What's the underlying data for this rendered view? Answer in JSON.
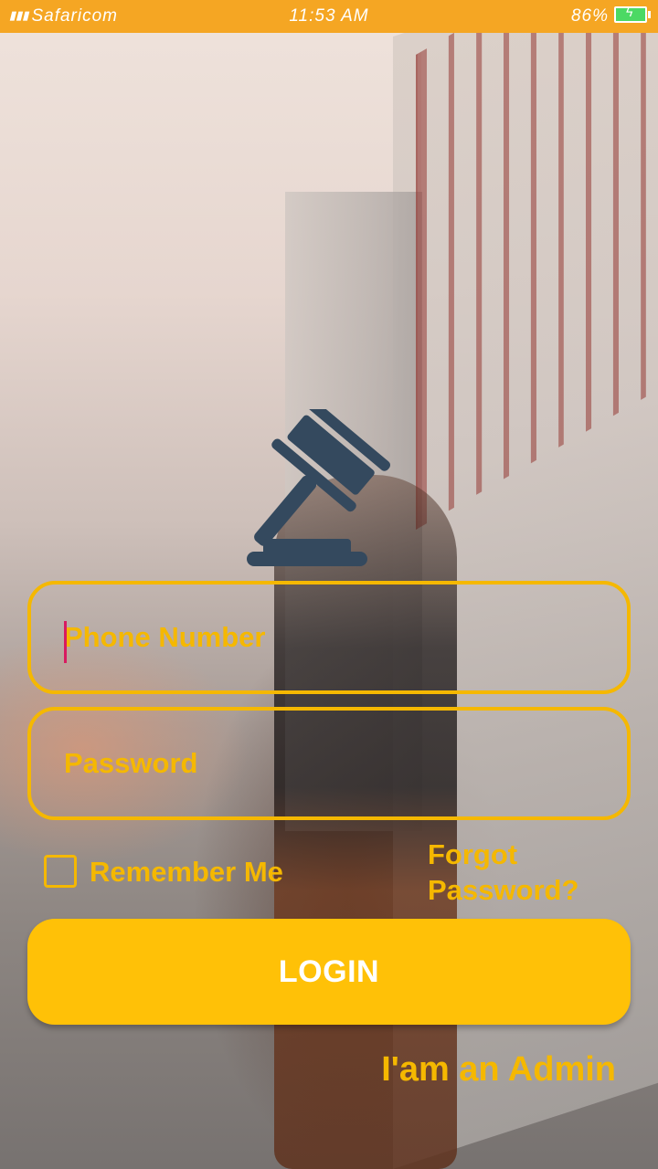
{
  "status_bar": {
    "carrier": "Safaricom",
    "time": "11:53 AM",
    "battery": "86%"
  },
  "logo": {
    "icon": "gavel-icon"
  },
  "form": {
    "phone_placeholder": "Phone Number",
    "password_placeholder": "Password",
    "remember_label": "Remember Me",
    "forgot_label": "Forgot Password?",
    "login_label": "LOGIN",
    "admin_label": "I'am an Admin"
  },
  "colors": {
    "accent": "#f5b800",
    "button": "#ffc107",
    "status_bar": "#f5a623",
    "logo": "#34495e"
  }
}
